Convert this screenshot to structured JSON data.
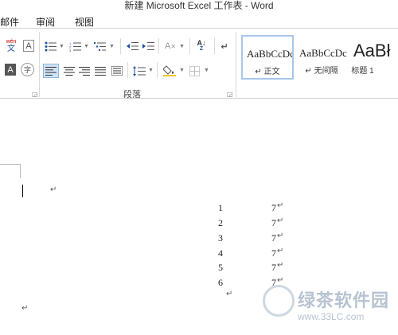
{
  "window": {
    "title": "新建 Microsoft Excel 工作表 - Word"
  },
  "tabs": [
    {
      "label": "邮件"
    },
    {
      "label": "审阅"
    },
    {
      "label": "视图"
    }
  ],
  "ribbon": {
    "font_group": {
      "phonetic_top": "wén",
      "phonetic_bottom": "文",
      "border_char": "A",
      "shading_char": "A",
      "enclose_char": "字"
    },
    "paragraph_group": {
      "label": "段落",
      "buttons": [
        {
          "name": "bullets",
          "icon": "bullets-icon",
          "glyph": "☰"
        },
        {
          "name": "numbering",
          "icon": "numbering-icon",
          "glyph": "☰"
        },
        {
          "name": "multilevel",
          "icon": "multilevel-list-icon",
          "glyph": "☰"
        },
        {
          "name": "decrease-indent",
          "icon": "decrease-indent-icon",
          "glyph": "⇤"
        },
        {
          "name": "increase-indent",
          "icon": "increase-indent-icon",
          "glyph": "⇥"
        },
        {
          "name": "chinese-layout",
          "icon": "chinese-layout-icon",
          "glyph": "A"
        },
        {
          "name": "sort",
          "icon": "sort-icon",
          "glyph": "A↓"
        },
        {
          "name": "show-marks",
          "icon": "paragraph-mark-icon",
          "glyph": "↵"
        },
        {
          "name": "align-left",
          "icon": "align-left-icon",
          "glyph": "≡"
        },
        {
          "name": "center",
          "icon": "align-center-icon",
          "glyph": "≡"
        },
        {
          "name": "align-right",
          "icon": "align-right-icon",
          "glyph": "≡"
        },
        {
          "name": "justify",
          "icon": "justify-icon",
          "glyph": "≡"
        },
        {
          "name": "distributed",
          "icon": "distributed-icon",
          "glyph": "▥"
        },
        {
          "name": "line-spacing",
          "icon": "line-spacing-icon",
          "glyph": "↕"
        },
        {
          "name": "shading",
          "icon": "shading-icon",
          "glyph": "◈"
        },
        {
          "name": "borders",
          "icon": "borders-icon",
          "glyph": "⊞"
        }
      ]
    },
    "styles": [
      {
        "sample": "AaBbCcDc",
        "name": "↵ 正文",
        "selected": true
      },
      {
        "sample": "AaBbCcDc",
        "name": "↵ 无间隔",
        "selected": false
      },
      {
        "sample": "AaBł",
        "name": "标题 1",
        "selected": false
      }
    ]
  },
  "document": {
    "paragraph_mark": "↵",
    "rows": [
      {
        "num": "1",
        "val": "7"
      },
      {
        "num": "2",
        "val": "7"
      },
      {
        "num": "3",
        "val": "7"
      },
      {
        "num": "4",
        "val": "7"
      },
      {
        "num": "5",
        "val": "7"
      },
      {
        "num": "6",
        "val": "7"
      }
    ]
  },
  "watermark": {
    "title": "绿茶软件园",
    "url": "www.33LC.com"
  },
  "colors": {
    "selected_style_border": "#a9c6e8",
    "selected_align_bg": "#cfe3f6",
    "watermark": "#b7c3d1"
  }
}
